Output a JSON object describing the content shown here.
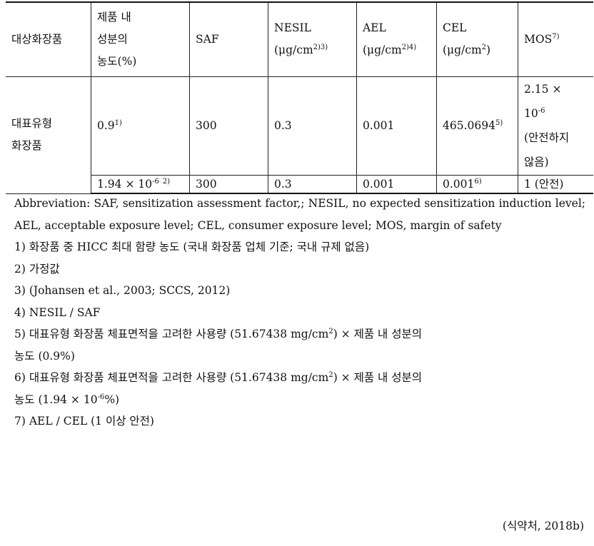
{
  "table": {
    "headers": [
      {
        "lines": [
          "제품 내",
          "성분의",
          "농도(%)"
        ]
      }
    ],
    "header_product": "대상화장품",
    "header_conc": [
      "제품 내",
      "성분의",
      "농도(%)"
    ],
    "header_saf": "SAF",
    "header_nesil": "NESIL",
    "header_nesil_unit": "(μg/cm",
    "header_nesil_sup": "2)",
    "header_nesil_ref": "3)",
    "header_ael": "AEL",
    "header_ael_unit": "(μg/cm",
    "header_ael_sup": "2)",
    "header_ael_ref": "4)",
    "header_cel": "CEL",
    "header_cel_unit": "(μg/cm",
    "header_cel_sup": "2",
    "header_cel_close": ")",
    "header_mos": "MOS",
    "header_mos_ref": "7)",
    "product": [
      "대표유형",
      "화장품"
    ],
    "rows": [
      {
        "conc": "0.9",
        "conc_ref": "1)",
        "saf": "300",
        "nesil": "0.3",
        "ael": "0.001",
        "cel": "465.0694",
        "cel_ref": "5)",
        "mos": [
          "2.15 ×",
          "10",
          "-6",
          "(안전하지",
          "않음)"
        ]
      },
      {
        "conc": "1.94 × 10",
        "conc_exp": "-6",
        "conc_ref": "2)",
        "saf": "300",
        "nesil": "0.3",
        "ael": "0.001",
        "cel": "0.001",
        "cel_ref": "6)",
        "mos": "1 (안전)"
      }
    ]
  },
  "notes": {
    "abbreviation": "Abbreviation: SAF, sensitization assessment factor,; NESIL, no expected sensitization induction level; AEL, acceptable exposure level; CEL, consumer exposure level; MOS, margin of safety",
    "n1": "1) 화장품 중 HICC 최대 함량 농도 (국내 화장품 업체 기준; 국내 규제 없음)",
    "n2": "2) 가정값",
    "n3": "3) (Johansen et al., 2003; SCCS, 2012)",
    "n4": "4) NESIL / SAF",
    "n5a": "5) 대표유형 화장품 체표면적을 고려한 사용량 (51.67438 mg/cm",
    "n5sup": "2",
    "n5b": ") × 제품 내 성분의",
    "n5c": "농도 (0.9%)",
    "n6a": "6) 대표유형 화장품 체표면적을 고려한 사용량 (51.67438 mg/cm",
    "n6sup": "2",
    "n6b": ") × 제품 내 성분의",
    "n6c": "농도 (1.94 × 10",
    "n6exp": "-6",
    "n6d": "%)",
    "n7": "7) AEL / CEL (1 이상 안전)"
  },
  "source": "(식약처, 2018b)"
}
